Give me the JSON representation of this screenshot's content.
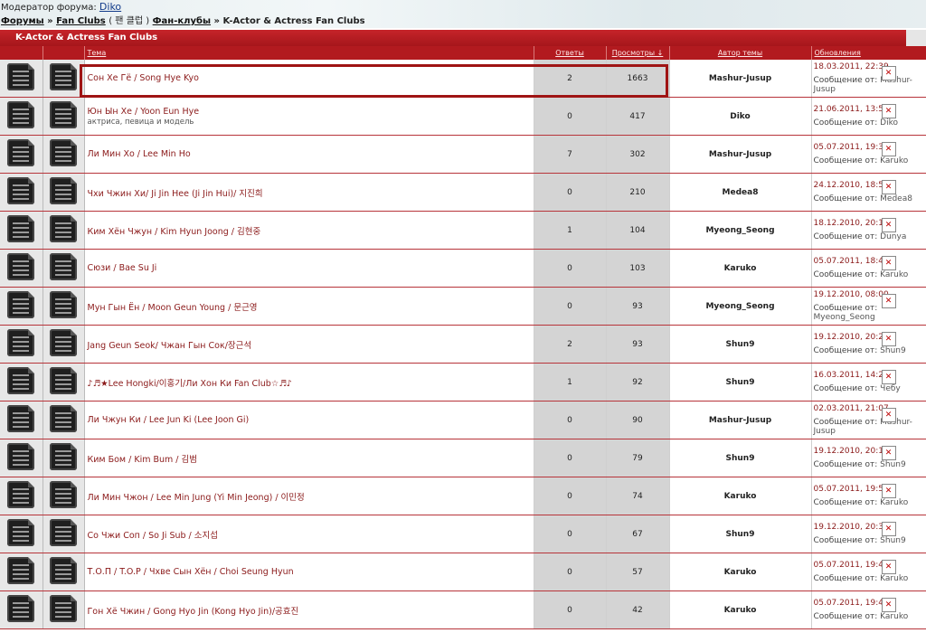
{
  "header": {
    "moderator_label": "Модератор форума:",
    "moderator_name": "Diko",
    "crumb_forums": "Форумы",
    "crumb_fanclubs": "Fan Clubs",
    "crumb_korean": "( 팬 클럽 )",
    "crumb_fanclubs_ru": "Фан-клубы",
    "crumb_current": "K-Actor & Actress Fan Clubs"
  },
  "band_title": "K-Actor & Actress Fan Clubs",
  "columns": {
    "topic": "Тема",
    "replies": "Ответы",
    "views": "Просмотры ↓",
    "author": "Автор темы",
    "updates": "Обновления"
  },
  "rows": [
    {
      "title": "Сон Хе Гё / Song Hye Kyo",
      "sub": "",
      "replies": "2",
      "views": "1663",
      "author": "Mashur-Jusup",
      "date": "18.03.2011, 22:39",
      "by_label": "Сообщение от:",
      "by": "Mashur-Jusup"
    },
    {
      "title": "Юн Ын Хе / Yoon Eun Hye",
      "sub": "актриса, певица и модель",
      "replies": "0",
      "views": "417",
      "author": "Diko",
      "date": "21.06.2011, 13:54",
      "by_label": "Сообщение от:",
      "by": "Diko"
    },
    {
      "title": "Ли Мин Хо / Lee Min Ho",
      "sub": "",
      "replies": "7",
      "views": "302",
      "author": "Mashur-Jusup",
      "date": "05.07.2011, 19:34",
      "by_label": "Сообщение от:",
      "by": "Karuko"
    },
    {
      "title": "Чхи Чжин Хи/ Ji Jin Hee (Ji Jin Hui)/ 지진희",
      "sub": "",
      "replies": "0",
      "views": "210",
      "author": "Medea8",
      "date": "24.12.2010, 18:51",
      "by_label": "Сообщение от:",
      "by": "Medea8"
    },
    {
      "title": "Ким Хён Чжун / Kim Hyun Joong / 김현중",
      "sub": "",
      "replies": "1",
      "views": "104",
      "author": "Myeong_Seong",
      "date": "18.12.2010, 20:18",
      "by_label": "Сообщение от:",
      "by": "Dunya"
    },
    {
      "title": "Сюзи / Bae Su Ji",
      "sub": "",
      "replies": "0",
      "views": "103",
      "author": "Karuko",
      "date": "05.07.2011, 18:49",
      "by_label": "Сообщение от:",
      "by": "Karuko"
    },
    {
      "title": "Мун Гын Ён / Moon Geun Young / 문근영",
      "sub": "",
      "replies": "0",
      "views": "93",
      "author": "Myeong_Seong",
      "date": "19.12.2010, 08:00",
      "by_label": "Сообщение от:",
      "by": "Myeong_Seong"
    },
    {
      "title": "Jang Geun Seok/ Чжан Гын Сок/장근석",
      "sub": "",
      "replies": "2",
      "views": "93",
      "author": "Shun9",
      "date": "19.12.2010, 20:25",
      "by_label": "Сообщение от:",
      "by": "Shun9"
    },
    {
      "title": "♪♬★Lee Hongki/이홍기/Ли Хон Ки Fan Club☆♬♪",
      "sub": "",
      "replies": "1",
      "views": "92",
      "author": "Shun9",
      "date": "16.03.2011, 14:21",
      "by_label": "Сообщение от:",
      "by": "Чебу"
    },
    {
      "title": "Ли Чжун Ки / Lee Jun Ki (Lee Joon Gi)",
      "sub": "",
      "replies": "0",
      "views": "90",
      "author": "Mashur-Jusup",
      "date": "02.03.2011, 21:07",
      "by_label": "Сообщение от:",
      "by": "Mashur-Jusup"
    },
    {
      "title": "Ким Бом / Kim Bum / 김범",
      "sub": "",
      "replies": "0",
      "views": "79",
      "author": "Shun9",
      "date": "19.12.2010, 20:10",
      "by_label": "Сообщение от:",
      "by": "Shun9"
    },
    {
      "title": "Ли Мин Чжон / Lee Min Jung (Yi Min Jeong) / 이민정",
      "sub": "",
      "replies": "0",
      "views": "74",
      "author": "Karuko",
      "date": "05.07.2011, 19:53",
      "by_label": "Сообщение от:",
      "by": "Karuko"
    },
    {
      "title": "Со Чжи Соп / So Ji Sub / 소지섭",
      "sub": "",
      "replies": "0",
      "views": "67",
      "author": "Shun9",
      "date": "19.12.2010, 20:37",
      "by_label": "Сообщение от:",
      "by": "Shun9"
    },
    {
      "title": "Т.О.П / T.O.P / Чхве Сын Хён / Choi Seung Hyun",
      "sub": "",
      "replies": "0",
      "views": "57",
      "author": "Karuko",
      "date": "05.07.2011, 19:44",
      "by_label": "Сообщение от:",
      "by": "Karuko"
    },
    {
      "title": "Гон Хё Чжин / Gong Hyo Jin (Kong Hyo Jin)/공효진",
      "sub": "",
      "replies": "0",
      "views": "42",
      "author": "Karuko",
      "date": "05.07.2011, 19:48",
      "by_label": "Сообщение от:",
      "by": "Karuko"
    }
  ],
  "icons": {
    "topic": "document-icon",
    "delete": "close-box-icon"
  },
  "colors": {
    "header_red": "#b21a1f",
    "text_red": "#8b1a1a",
    "count_bg": "#d4d4d4"
  }
}
